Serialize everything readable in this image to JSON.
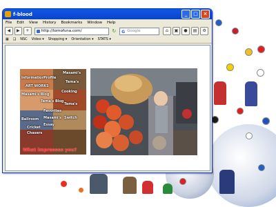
{
  "window": {
    "title": "f-blood",
    "controls": [
      "_",
      "□",
      "×"
    ]
  },
  "menubar": {
    "items": [
      "File",
      "Edit",
      "View",
      "History",
      "Bookmarks",
      "Window",
      "Help"
    ]
  },
  "navbar": {
    "url": "http://tomofuna.com/",
    "search_placeholder": "Google"
  },
  "bookmarks": {
    "items": [
      "NSC",
      "Video ▾",
      "Shopping ▾",
      "Orientation ▾",
      "STATS ▾"
    ]
  },
  "collage": {
    "labels": [
      "Information",
      "Profile",
      "Masami's",
      "Tema's",
      "ART WORKS",
      "Cooking",
      "Masami's Blog",
      "Tema's Blog",
      "Favorites",
      "Tema's",
      "Masami's",
      "Essay",
      "Switch",
      "Ballroom",
      "Cricket",
      "Chasers"
    ],
    "bottom_text": "What impresses you?"
  }
}
